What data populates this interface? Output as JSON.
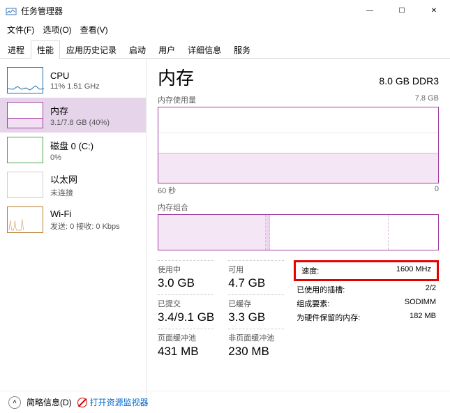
{
  "window": {
    "title": "任务管理器",
    "minimize": "—",
    "maximize": "☐",
    "close": "✕"
  },
  "menu": {
    "file": "文件(F)",
    "options": "选项(O)",
    "view": "查看(V)"
  },
  "tabs": {
    "processes": "进程",
    "performance": "性能",
    "app_history": "应用历史记录",
    "startup": "启动",
    "users": "用户",
    "details": "详细信息",
    "services": "服务"
  },
  "sidebar": {
    "cpu": {
      "title": "CPU",
      "sub": "11%  1.51 GHz"
    },
    "mem": {
      "title": "内存",
      "sub": "3.1/7.8 GB (40%)"
    },
    "disk": {
      "title": "磁盘 0 (C:)",
      "sub": "0%"
    },
    "eth": {
      "title": "以太网",
      "sub": "未连接"
    },
    "wifi": {
      "title": "Wi-Fi",
      "sub": "发送: 0  接收: 0 Kbps"
    }
  },
  "detail": {
    "heading": "内存",
    "capacity": "8.0 GB DDR3",
    "usage_label": "内存使用量",
    "usage_max": "7.8 GB",
    "x_left": "60 秒",
    "x_right": "0",
    "comp_label": "内存组合",
    "stats": {
      "in_use_lbl": "使用中",
      "in_use_val": "3.0 GB",
      "avail_lbl": "可用",
      "avail_val": "4.7 GB",
      "commit_lbl": "已提交",
      "commit_val": "3.4/9.1 GB",
      "cached_lbl": "已缓存",
      "cached_val": "3.3 GB",
      "paged_lbl": "页面缓冲池",
      "paged_val": "431 MB",
      "nonpaged_lbl": "非页面缓冲池",
      "nonpaged_val": "230 MB"
    },
    "info": {
      "speed_lbl": "速度:",
      "speed_val": "1600 MHz",
      "slots_lbl": "已使用的插槽:",
      "slots_val": "2/2",
      "form_lbl": "组成要素:",
      "form_val": "SODIMM",
      "reserved_lbl": "为硬件保留的内存:",
      "reserved_val": "182 MB"
    }
  },
  "footer": {
    "fewer": "简略信息(D)",
    "resmon": "打开资源监视器"
  },
  "chart_data": {
    "type": "line",
    "title": "内存使用量",
    "x_range_seconds": [
      60,
      0
    ],
    "ylim_gb": [
      0,
      7.8
    ],
    "memory_used_gb_approx": [
      3.0,
      3.0,
      3.0,
      3.0,
      3.0,
      3.0,
      3.0,
      3.0,
      3.0,
      3.0,
      3.0,
      3.0,
      3.0,
      3.0,
      3.0,
      3.0,
      3.0,
      3.0,
      3.0,
      3.0
    ],
    "composition_gb": {
      "in_use": 3.0,
      "modified": 0.1,
      "standby": 3.3,
      "free": 1.4
    }
  }
}
